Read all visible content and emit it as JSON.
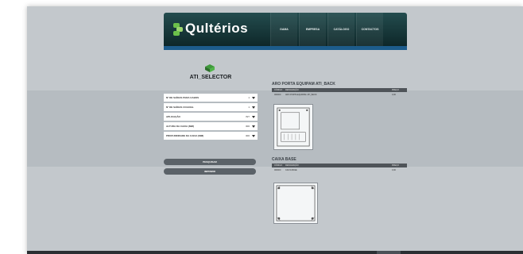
{
  "header": {
    "logo_text": "Qultérios",
    "nav": [
      {
        "label": "GAMA"
      },
      {
        "label": "EMPRESA"
      },
      {
        "label": "CATÁLOGO"
      },
      {
        "label": "CONTACTOS"
      }
    ]
  },
  "selector": {
    "title": "ATI_SELECTOR",
    "icon": "product-box-icon",
    "fields": [
      {
        "label": "Nº DE SAÍDAS PARA CABOS",
        "value": "1"
      },
      {
        "label": "Nº DE SAÍDAS COAXIAL",
        "value": "1"
      },
      {
        "label": "APLICAÇÃO",
        "value": "INT"
      },
      {
        "label": "ALTURA DA CAIXA (MM)",
        "value": "300"
      },
      {
        "label": "PROFUNDIDADE DA CAIXA (MM)",
        "value": "300"
      }
    ],
    "search_label": "PESQUISAR",
    "print_label": "IMPRIMIR"
  },
  "results": [
    {
      "title": "ARO PORTA EQUIPAM ATI_BACK",
      "columns": [
        "CÓDIGO",
        "DESIGNAÇÃO",
        "PREÇO"
      ],
      "rows": [
        {
          "code": "000000",
          "name": "ARO PORTA EQUIPAM. ATI_BACK",
          "price": "0,00"
        }
      ]
    },
    {
      "title": "CAIXA BASE",
      "columns": [
        "CÓDIGO",
        "DESIGNAÇÃO",
        "PREÇO"
      ],
      "rows": [
        {
          "code": "000000",
          "name": "CAIXA BASE",
          "price": "0,00"
        }
      ]
    }
  ],
  "colors": {
    "header_bg": "#1a3b3d",
    "accent_bar": "#1d5c8b",
    "logo_green": "#6cc04a",
    "button_bg": "#5b6268"
  }
}
